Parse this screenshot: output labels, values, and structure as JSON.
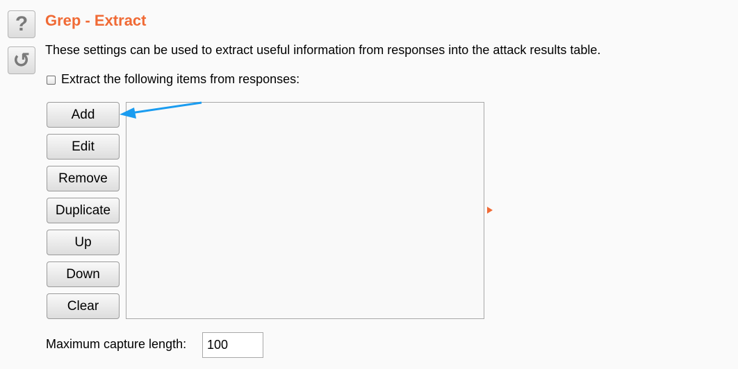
{
  "side_toolbar": {
    "help_glyph": "?",
    "refresh_glyph": "↺",
    "help_icon": "question-icon",
    "refresh_icon": "refresh-icon"
  },
  "section": {
    "title": "Grep - Extract",
    "description": "These settings can be used to extract useful information from responses into the attack results table.",
    "checkbox_label": "Extract the following items from responses:",
    "checkbox_checked": false
  },
  "buttons": {
    "add": "Add",
    "edit": "Edit",
    "remove": "Remove",
    "duplicate": "Duplicate",
    "up": "Up",
    "down": "Down",
    "clear": "Clear"
  },
  "extract_list": {
    "items": []
  },
  "capture": {
    "label": "Maximum capture length:",
    "value": "100"
  },
  "colors": {
    "title": "#f06a35",
    "annotation_arrow": "#1a9cf0"
  }
}
